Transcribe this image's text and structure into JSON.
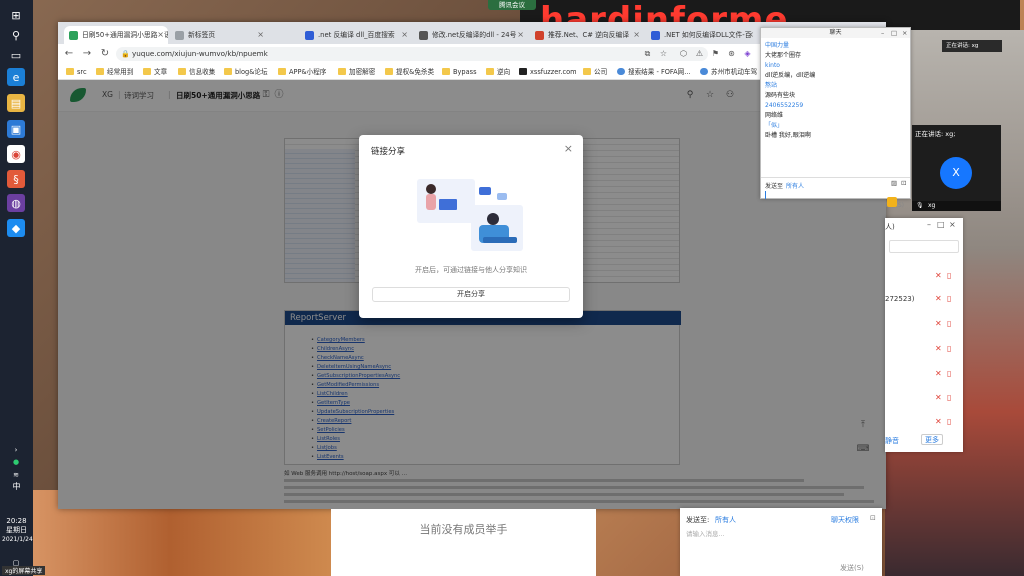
{
  "wallpaper": {
    "banner_text": "hardinforme"
  },
  "taskbar": {
    "time": "20:28",
    "weekday": "星期日",
    "date": "2021/1/24",
    "ime": "中"
  },
  "meeting_tag": "腾讯会议",
  "browser": {
    "tabs": [
      {
        "label": "日刷50+通用漏洞小思路 · 语",
        "active": true,
        "color": "#2ca15a"
      },
      {
        "label": "新标签页",
        "active": false,
        "color": "#9aa0a6"
      },
      {
        "label": ".net 反编译 dll_百度搜索",
        "active": false,
        "color": "#2f5dd6"
      },
      {
        "label": "修改.net反编译的dll - 24号",
        "active": false,
        "color": "#555555"
      },
      {
        "label": "推荐.Net、C# 逆向反编译",
        "active": false,
        "color": "#d0412b"
      },
      {
        "label": ".NET 如何反编译DLL文件-百",
        "active": false,
        "color": "#2f5dd6"
      }
    ],
    "url": "yuque.com/xiujun-wumvo/kb/npuemk",
    "bookmarks": [
      {
        "label": "src",
        "kind": "folder"
      },
      {
        "label": "经常用到",
        "kind": "folder"
      },
      {
        "label": "文章",
        "kind": "folder"
      },
      {
        "label": "信息收集",
        "kind": "folder"
      },
      {
        "label": "blog&论坛",
        "kind": "folder"
      },
      {
        "label": "APP&小程序",
        "kind": "folder"
      },
      {
        "label": "加密解密",
        "kind": "folder"
      },
      {
        "label": "提权&免杀类",
        "kind": "folder"
      },
      {
        "label": "Bypass",
        "kind": "folder"
      },
      {
        "label": "逆向",
        "kind": "folder"
      },
      {
        "label": "xssfuzzer.com",
        "kind": "site"
      },
      {
        "label": "公司",
        "kind": "folder"
      },
      {
        "label": "搜索结果 - FOFA网...",
        "kind": "g"
      },
      {
        "label": "苏州市机动车驾",
        "kind": "g"
      }
    ]
  },
  "page": {
    "breadcrumbs": [
      "XG",
      "|",
      "诗词学习",
      "|",
      "日刷50+通用漏洞小思路"
    ],
    "report_server": {
      "title": "ReportServer",
      "links": [
        "CategoryMembers",
        "ChildrenAsync",
        "CheckNameAsync",
        "DeleteItemUsingNameAsync",
        "GetSubscriptionPropertiesAsync",
        "GetModifiedPermissions",
        "ListChildren",
        "GetItemType",
        "UpdateSubscriptionProperties",
        "CreateReport",
        "SetPolicies",
        "ListRoles",
        "ListJobs",
        "ListEvents"
      ]
    },
    "para_heading": "如 Web 服务调用 http://host/soap.aspx 可以 …"
  },
  "modal": {
    "title": "链接分享",
    "hint": "开启后，可通过链接与他人分享知识",
    "button": "开启分享"
  },
  "chat": {
    "title": "聊天",
    "messages": [
      {
        "type": "name",
        "text": "中国力量"
      },
      {
        "type": "body",
        "text": "大佬那个圈存"
      },
      {
        "type": "name",
        "text": "kinto"
      },
      {
        "type": "body",
        "text": "dll逆反编，dll逆编"
      },
      {
        "type": "name",
        "text": "熬站"
      },
      {
        "type": "body",
        "text": "源码有些块"
      },
      {
        "type": "name",
        "text": "2406552259"
      },
      {
        "type": "body",
        "text": "网络维"
      },
      {
        "type": "name",
        "text": "「似」"
      },
      {
        "type": "body",
        "text": "卧槽 我好,眼泪啊"
      }
    ],
    "send_to_label": "发送至",
    "send_to_value": "所有人",
    "send_button": "发送(S)"
  },
  "video": {
    "label": "正在讲话: xg;",
    "avatar_letter": "X",
    "footer_name": "xg"
  },
  "meet_strip": "正在讲话: xg",
  "members": {
    "title": "人)",
    "rows": [
      "",
      "",
      "272523)",
      "",
      "",
      "",
      "",
      ""
    ],
    "mute_label": "静音",
    "more_label": "更多"
  },
  "meeting_chat": {
    "send_to_label": "发送至:",
    "send_to_value": "所有人",
    "permission": "聊天权限",
    "placeholder": "请输入消息...",
    "send_button": "发送(S)"
  },
  "hands_panel": {
    "text": "当前没有成员举手"
  },
  "taskbar_bottom_label": "xg的屏幕共享"
}
